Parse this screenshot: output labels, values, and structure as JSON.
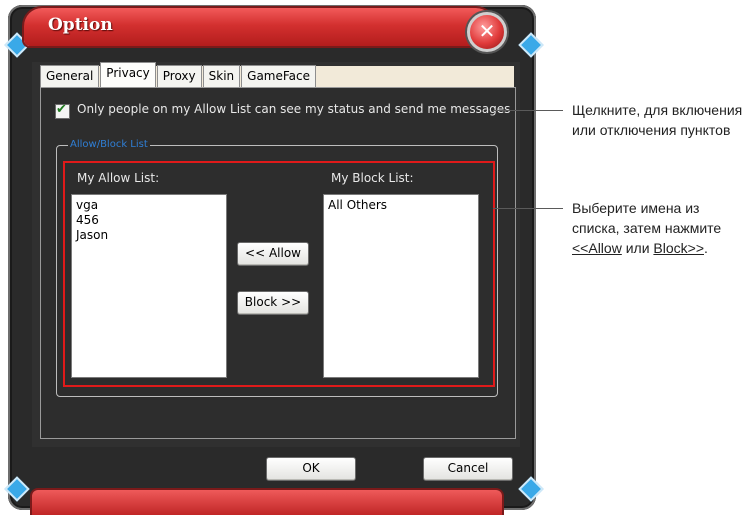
{
  "window": {
    "title": "Option",
    "close_glyph": "✕"
  },
  "tabs": [
    {
      "label": "General",
      "active": false
    },
    {
      "label": "Privacy",
      "active": true
    },
    {
      "label": "Proxy",
      "active": false
    },
    {
      "label": "Skin",
      "active": false
    },
    {
      "label": "GameFace",
      "active": false
    }
  ],
  "privacy": {
    "allow_only_checkbox": {
      "checked": true,
      "label": "Only people on my Allow List can see my status and send me messages"
    },
    "group_legend": "Allow/Block List",
    "allow_list_label": "My Allow List:",
    "allow_list_items": [
      "vga",
      "456",
      "Jason"
    ],
    "block_list_label": "My Block List:",
    "block_list_items": [
      "All Others"
    ],
    "allow_button": "<< Allow",
    "block_button": "Block >>"
  },
  "footer": {
    "ok": "OK",
    "cancel": "Cancel"
  },
  "callouts": {
    "checkbox_note": [
      "Щелкните, для включения",
      "или отключения пунктов"
    ],
    "lists_note_1": "Выберите имена из",
    "lists_note_2": "списка, затем нажмите",
    "lists_note_allow": "<<Allow",
    "lists_note_or": " или ",
    "lists_note_block": "Block>>",
    "lists_note_end": "."
  },
  "colors": {
    "title_red": "#d3302f",
    "highlight_red": "#e01a1a",
    "legend_blue": "#2f7fd6",
    "check_green": "#1f7a1f"
  }
}
